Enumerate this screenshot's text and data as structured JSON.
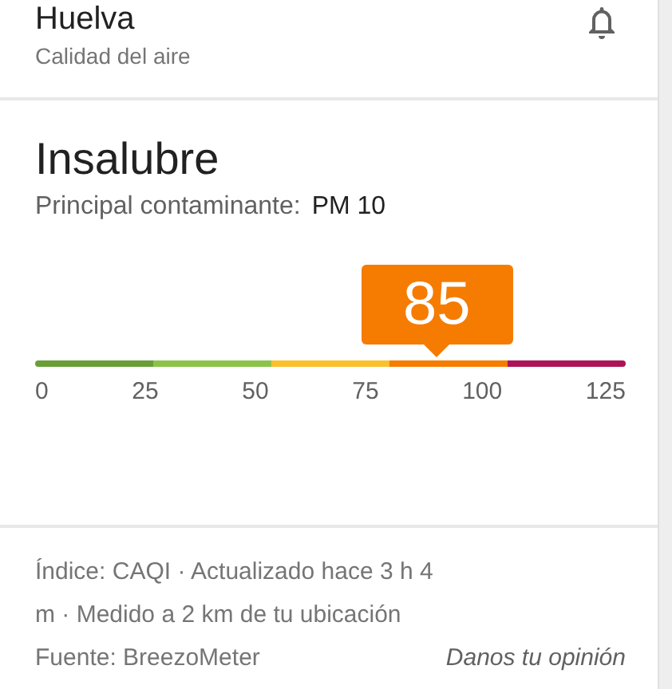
{
  "header": {
    "title": "Huelva",
    "subtitle": "Calidad del aire"
  },
  "summary": {
    "category": "Insalubre",
    "pollutant_label": "Principal contaminante:",
    "pollutant": "PM 10"
  },
  "gauge": {
    "value": "85",
    "color": "#f57c00",
    "segments": [
      {
        "color": "#689f38"
      },
      {
        "color": "#8bc34a"
      },
      {
        "color": "#fbc02d"
      },
      {
        "color": "#f57c00"
      },
      {
        "color": "#ad1457"
      }
    ],
    "ticks": [
      "0",
      "25",
      "50",
      "75",
      "100",
      "125"
    ]
  },
  "footer": {
    "info_lines": [
      "Índice: CAQI · Actualizado hace 3 h 4",
      "m · Medido a 2 km de tu ubicación"
    ],
    "source": "Fuente: BreezoMeter",
    "feedback_link": "Danos tu opinión"
  }
}
